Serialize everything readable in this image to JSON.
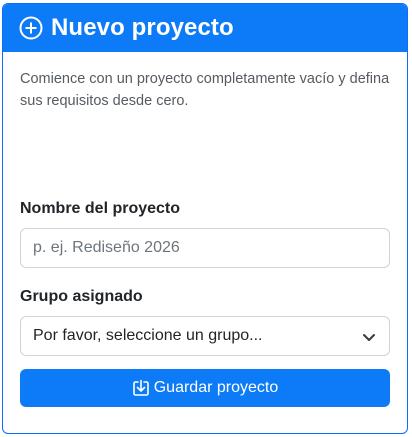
{
  "header": {
    "title": "Nuevo proyecto",
    "icon": "plus-circle-icon"
  },
  "description": "Comience con un proyecto completamente vacío y defina sus requisitos desde cero.",
  "form": {
    "name_label": "Nombre del proyecto",
    "name_placeholder": "p. ej. Rediseño 2026",
    "name_value": "",
    "group_label": "Grupo asignado",
    "group_selected": "Por favor, seleccione un grupo...",
    "group_icon": "chevron-down-icon",
    "save_label": "Guardar proyecto",
    "save_icon": "download-arrow-icon"
  },
  "colors": {
    "accent": "#0d7bf7",
    "border": "#ced4da",
    "muted_text": "#555b61"
  }
}
